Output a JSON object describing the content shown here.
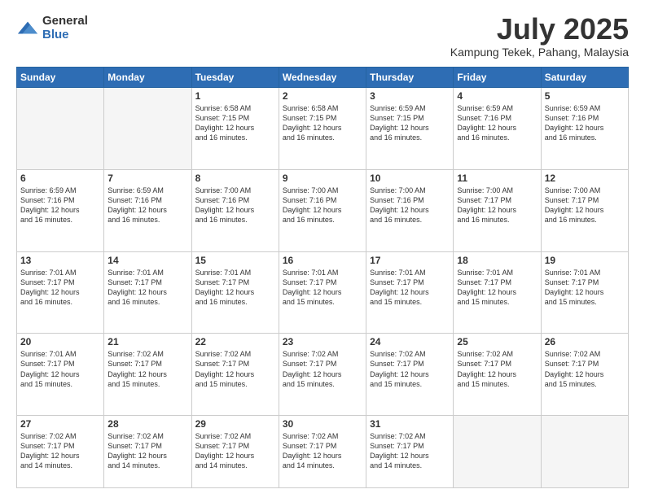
{
  "logo": {
    "general": "General",
    "blue": "Blue"
  },
  "header": {
    "month": "July 2025",
    "location": "Kampung Tekek, Pahang, Malaysia"
  },
  "weekdays": [
    "Sunday",
    "Monday",
    "Tuesday",
    "Wednesday",
    "Thursday",
    "Friday",
    "Saturday"
  ],
  "weeks": [
    [
      {
        "day": "",
        "info": ""
      },
      {
        "day": "",
        "info": ""
      },
      {
        "day": "1",
        "info": "Sunrise: 6:58 AM\nSunset: 7:15 PM\nDaylight: 12 hours\nand 16 minutes."
      },
      {
        "day": "2",
        "info": "Sunrise: 6:58 AM\nSunset: 7:15 PM\nDaylight: 12 hours\nand 16 minutes."
      },
      {
        "day": "3",
        "info": "Sunrise: 6:59 AM\nSunset: 7:15 PM\nDaylight: 12 hours\nand 16 minutes."
      },
      {
        "day": "4",
        "info": "Sunrise: 6:59 AM\nSunset: 7:16 PM\nDaylight: 12 hours\nand 16 minutes."
      },
      {
        "day": "5",
        "info": "Sunrise: 6:59 AM\nSunset: 7:16 PM\nDaylight: 12 hours\nand 16 minutes."
      }
    ],
    [
      {
        "day": "6",
        "info": "Sunrise: 6:59 AM\nSunset: 7:16 PM\nDaylight: 12 hours\nand 16 minutes."
      },
      {
        "day": "7",
        "info": "Sunrise: 6:59 AM\nSunset: 7:16 PM\nDaylight: 12 hours\nand 16 minutes."
      },
      {
        "day": "8",
        "info": "Sunrise: 7:00 AM\nSunset: 7:16 PM\nDaylight: 12 hours\nand 16 minutes."
      },
      {
        "day": "9",
        "info": "Sunrise: 7:00 AM\nSunset: 7:16 PM\nDaylight: 12 hours\nand 16 minutes."
      },
      {
        "day": "10",
        "info": "Sunrise: 7:00 AM\nSunset: 7:16 PM\nDaylight: 12 hours\nand 16 minutes."
      },
      {
        "day": "11",
        "info": "Sunrise: 7:00 AM\nSunset: 7:17 PM\nDaylight: 12 hours\nand 16 minutes."
      },
      {
        "day": "12",
        "info": "Sunrise: 7:00 AM\nSunset: 7:17 PM\nDaylight: 12 hours\nand 16 minutes."
      }
    ],
    [
      {
        "day": "13",
        "info": "Sunrise: 7:01 AM\nSunset: 7:17 PM\nDaylight: 12 hours\nand 16 minutes."
      },
      {
        "day": "14",
        "info": "Sunrise: 7:01 AM\nSunset: 7:17 PM\nDaylight: 12 hours\nand 16 minutes."
      },
      {
        "day": "15",
        "info": "Sunrise: 7:01 AM\nSunset: 7:17 PM\nDaylight: 12 hours\nand 16 minutes."
      },
      {
        "day": "16",
        "info": "Sunrise: 7:01 AM\nSunset: 7:17 PM\nDaylight: 12 hours\nand 15 minutes."
      },
      {
        "day": "17",
        "info": "Sunrise: 7:01 AM\nSunset: 7:17 PM\nDaylight: 12 hours\nand 15 minutes."
      },
      {
        "day": "18",
        "info": "Sunrise: 7:01 AM\nSunset: 7:17 PM\nDaylight: 12 hours\nand 15 minutes."
      },
      {
        "day": "19",
        "info": "Sunrise: 7:01 AM\nSunset: 7:17 PM\nDaylight: 12 hours\nand 15 minutes."
      }
    ],
    [
      {
        "day": "20",
        "info": "Sunrise: 7:01 AM\nSunset: 7:17 PM\nDaylight: 12 hours\nand 15 minutes."
      },
      {
        "day": "21",
        "info": "Sunrise: 7:02 AM\nSunset: 7:17 PM\nDaylight: 12 hours\nand 15 minutes."
      },
      {
        "day": "22",
        "info": "Sunrise: 7:02 AM\nSunset: 7:17 PM\nDaylight: 12 hours\nand 15 minutes."
      },
      {
        "day": "23",
        "info": "Sunrise: 7:02 AM\nSunset: 7:17 PM\nDaylight: 12 hours\nand 15 minutes."
      },
      {
        "day": "24",
        "info": "Sunrise: 7:02 AM\nSunset: 7:17 PM\nDaylight: 12 hours\nand 15 minutes."
      },
      {
        "day": "25",
        "info": "Sunrise: 7:02 AM\nSunset: 7:17 PM\nDaylight: 12 hours\nand 15 minutes."
      },
      {
        "day": "26",
        "info": "Sunrise: 7:02 AM\nSunset: 7:17 PM\nDaylight: 12 hours\nand 15 minutes."
      }
    ],
    [
      {
        "day": "27",
        "info": "Sunrise: 7:02 AM\nSunset: 7:17 PM\nDaylight: 12 hours\nand 14 minutes."
      },
      {
        "day": "28",
        "info": "Sunrise: 7:02 AM\nSunset: 7:17 PM\nDaylight: 12 hours\nand 14 minutes."
      },
      {
        "day": "29",
        "info": "Sunrise: 7:02 AM\nSunset: 7:17 PM\nDaylight: 12 hours\nand 14 minutes."
      },
      {
        "day": "30",
        "info": "Sunrise: 7:02 AM\nSunset: 7:17 PM\nDaylight: 12 hours\nand 14 minutes."
      },
      {
        "day": "31",
        "info": "Sunrise: 7:02 AM\nSunset: 7:17 PM\nDaylight: 12 hours\nand 14 minutes."
      },
      {
        "day": "",
        "info": ""
      },
      {
        "day": "",
        "info": ""
      }
    ]
  ]
}
